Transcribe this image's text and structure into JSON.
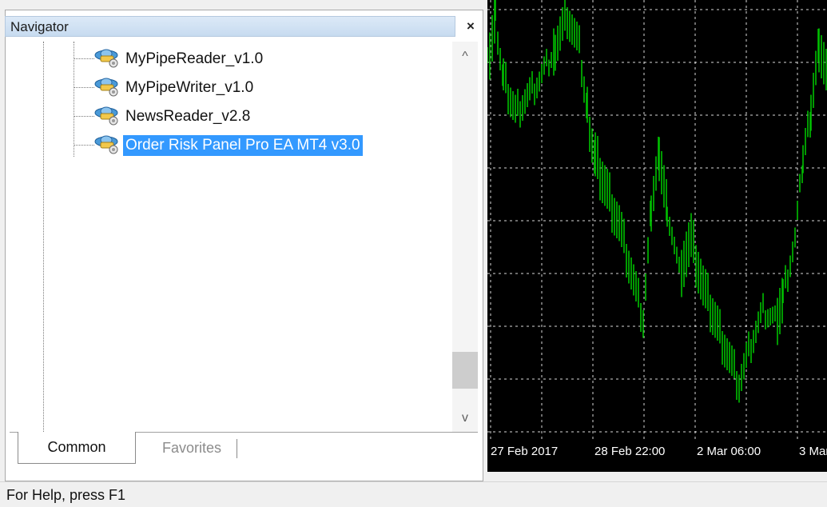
{
  "navigator": {
    "title": "Navigator",
    "close_symbol": "×",
    "items": [
      {
        "label": "MyPipeReader_v1.0",
        "icon": "expert-advisor-icon",
        "selected": false
      },
      {
        "label": "MyPipeWriter_v1.0",
        "icon": "expert-advisor-icon",
        "selected": false
      },
      {
        "label": "NewsReader_v2.8",
        "icon": "expert-advisor-icon",
        "selected": false
      },
      {
        "label": "Order Risk Panel Pro EA MT4 v3.0",
        "icon": "expert-advisor-icon",
        "selected": true
      }
    ],
    "scroll_up_symbol": "^",
    "scroll_down_symbol": "v",
    "tabs": [
      {
        "label": "Common",
        "active": true
      },
      {
        "label": "Favorites",
        "active": false
      }
    ]
  },
  "chart": {
    "background": "#000000",
    "bar_color": "#00c000",
    "grid_color": "#ffffff",
    "x_labels": [
      "27 Feb 2017",
      "28 Feb 22:00",
      "2 Mar 06:00",
      "3 Mar"
    ]
  },
  "status": {
    "text": "For Help, press F1"
  },
  "colors": {
    "selection": "#3399ff",
    "titlebar": "#c7dbf0"
  }
}
